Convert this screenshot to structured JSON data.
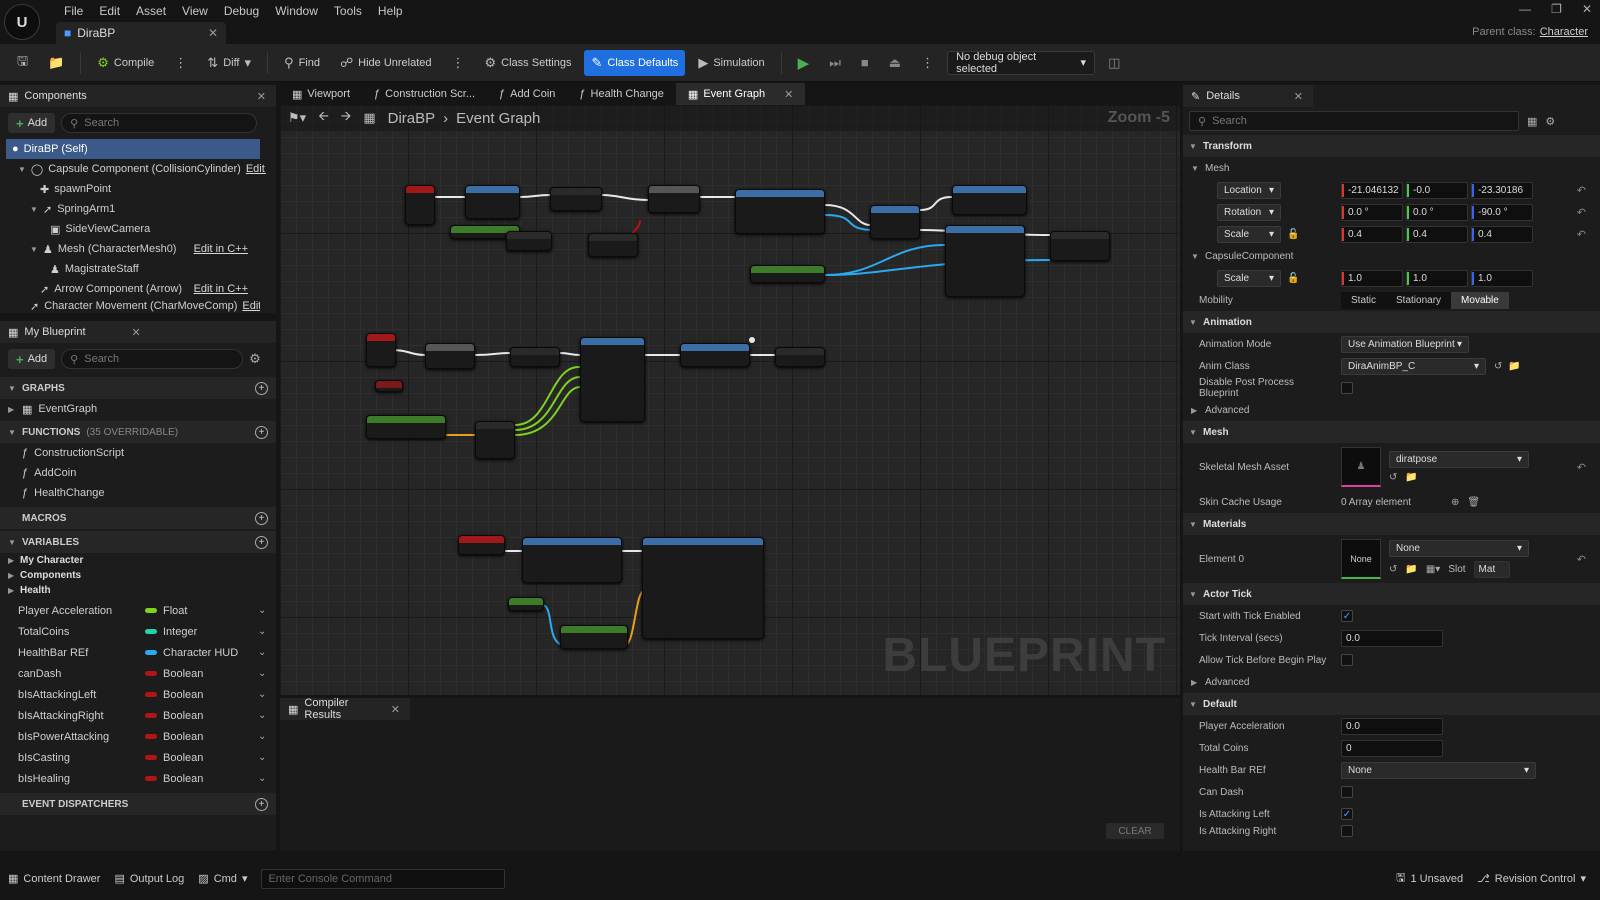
{
  "window": {
    "menus": [
      "File",
      "Edit",
      "Asset",
      "View",
      "Debug",
      "Window",
      "Tools",
      "Help"
    ],
    "asset_tab": "DiraBP",
    "parent_label": "Parent class:",
    "parent_value": "Character"
  },
  "toolbar": {
    "compile": "Compile",
    "diff": "Diff",
    "find": "Find",
    "hide_unrelated": "Hide Unrelated",
    "class_settings": "Class Settings",
    "class_defaults": "Class Defaults",
    "simulation": "Simulation",
    "debug_object": "No debug object selected"
  },
  "components": {
    "title": "Components",
    "add": "Add",
    "search_placeholder": "Search",
    "items": [
      {
        "label": "DiraBP (Self)",
        "edit": ""
      },
      {
        "label": "Capsule Component (CollisionCylinder)",
        "edit": "Edit i"
      },
      {
        "label": "spawnPoint",
        "edit": ""
      },
      {
        "label": "SpringArm1",
        "edit": ""
      },
      {
        "label": "SideViewCamera",
        "edit": ""
      },
      {
        "label": "Mesh (CharacterMesh0)",
        "edit": "Edit in C++"
      },
      {
        "label": "MagistrateStaff",
        "edit": ""
      },
      {
        "label": "Arrow Component (Arrow)",
        "edit": "Edit in C++"
      },
      {
        "label": "Character Movement (CharMoveComp)",
        "edit": "Edit"
      }
    ]
  },
  "my_blueprint": {
    "title": "My Blueprint",
    "add": "Add",
    "search_placeholder": "Search",
    "graphs_label": "GRAPHS",
    "graphs": [
      "EventGraph"
    ],
    "functions_label": "FUNCTIONS",
    "functions_count": "(35 OVERRIDABLE)",
    "functions": [
      "ConstructionScript",
      "AddCoin",
      "HealthChange"
    ],
    "macros_label": "MACROS",
    "variables_label": "VARIABLES",
    "categories": [
      "My Character",
      "Components",
      "Health"
    ],
    "variables": [
      {
        "name": "Player Acceleration",
        "type": "Float",
        "color": "#7ed321"
      },
      {
        "name": "TotalCoins",
        "type": "Integer",
        "color": "#1fd4a8"
      },
      {
        "name": "HealthBar REf",
        "type": "Character HUD",
        "color": "#2aa9f0"
      },
      {
        "name": "canDash",
        "type": "Boolean",
        "color": "#b31414"
      },
      {
        "name": "bIsAttackingLeft",
        "type": "Boolean",
        "color": "#b31414"
      },
      {
        "name": "bIsAttackingRight",
        "type": "Boolean",
        "color": "#b31414"
      },
      {
        "name": "bIsPowerAttacking",
        "type": "Boolean",
        "color": "#b31414"
      },
      {
        "name": "bIsCasting",
        "type": "Boolean",
        "color": "#b31414"
      },
      {
        "name": "bIsHealing",
        "type": "Boolean",
        "color": "#b31414"
      }
    ],
    "dispatchers_label": "EVENT DISPATCHERS"
  },
  "graph": {
    "tabs": [
      "Viewport",
      "Construction Scr...",
      "Add Coin",
      "Health Change",
      "Event Graph"
    ],
    "breadcrumb_root": "DiraBP",
    "breadcrumb_leaf": "Event Graph",
    "zoom": "Zoom -5",
    "watermark": "BLUEPRINT"
  },
  "compiler": {
    "title": "Compiler Results",
    "clear": "CLEAR"
  },
  "details": {
    "title": "Details",
    "search_placeholder": "Search",
    "transform": "Transform",
    "mesh": "Mesh",
    "location_label": "Location",
    "location": [
      "-21.046132",
      "-0.0",
      "-23.30186"
    ],
    "rotation_label": "Rotation",
    "rotation": [
      "0.0 °",
      "0.0 °",
      "-90.0 °"
    ],
    "scale_label": "Scale",
    "scale": [
      "0.4",
      "0.4",
      "0.4"
    ],
    "capsule": "CapsuleComponent",
    "capsule_scale": [
      "1.0",
      "1.0",
      "1.0"
    ],
    "mobility_label": "Mobility",
    "mobility": [
      "Static",
      "Stationary",
      "Movable"
    ],
    "animation": "Animation",
    "anim_mode_label": "Animation Mode",
    "anim_mode": "Use Animation Blueprint",
    "anim_class_label": "Anim Class",
    "anim_class": "DiraAnimBP_C",
    "disable_pp_label": "Disable Post Process Blueprint",
    "advanced": "Advanced",
    "mesh2": "Mesh",
    "skeletal_label": "Skeletal Mesh Asset",
    "skeletal_value": "diratpose",
    "skin_cache_label": "Skin Cache Usage",
    "skin_cache_value": "0 Array element",
    "materials": "Materials",
    "element0_label": "Element 0",
    "element0_thumb": "None",
    "element0_value": "None",
    "slot_label": "Slot",
    "slot_value": "Mat",
    "actor_tick": "Actor Tick",
    "tick_enabled_label": "Start with Tick Enabled",
    "tick_interval_label": "Tick Interval (secs)",
    "tick_interval": "0.0",
    "allow_tick_label": "Allow Tick Before Begin Play",
    "advanced2": "Advanced",
    "default": "Default",
    "player_accel_label": "Player Acceleration",
    "player_accel": "0.0",
    "total_coins_label": "Total Coins",
    "total_coins": "0",
    "health_bar_label": "Health Bar REf",
    "health_bar": "None",
    "can_dash_label": "Can Dash",
    "attacking_left_label": "Is Attacking Left",
    "attacking_right_label": "Is Attacking Right"
  },
  "status": {
    "content_drawer": "Content Drawer",
    "output_log": "Output Log",
    "cmd": "Cmd",
    "console_placeholder": "Enter Console Command",
    "unsaved": "1 Unsaved",
    "revision": "Revision Control"
  }
}
